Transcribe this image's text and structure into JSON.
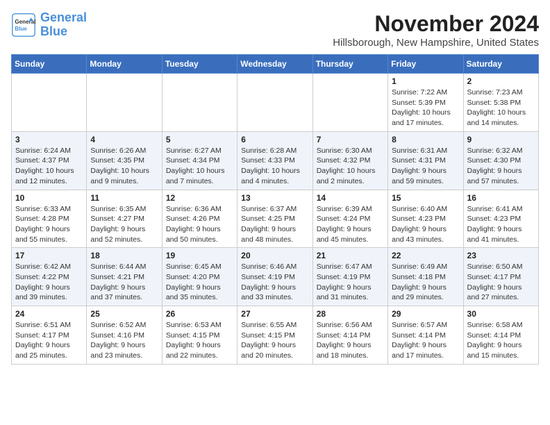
{
  "logo": {
    "text_general": "General",
    "text_blue": "Blue"
  },
  "header": {
    "month_year": "November 2024",
    "location": "Hillsborough, New Hampshire, United States"
  },
  "weekdays": [
    "Sunday",
    "Monday",
    "Tuesday",
    "Wednesday",
    "Thursday",
    "Friday",
    "Saturday"
  ],
  "weeks": [
    [
      {
        "day": "",
        "info": ""
      },
      {
        "day": "",
        "info": ""
      },
      {
        "day": "",
        "info": ""
      },
      {
        "day": "",
        "info": ""
      },
      {
        "day": "",
        "info": ""
      },
      {
        "day": "1",
        "info": "Sunrise: 7:22 AM\nSunset: 5:39 PM\nDaylight: 10 hours and 17 minutes."
      },
      {
        "day": "2",
        "info": "Sunrise: 7:23 AM\nSunset: 5:38 PM\nDaylight: 10 hours and 14 minutes."
      }
    ],
    [
      {
        "day": "3",
        "info": "Sunrise: 6:24 AM\nSunset: 4:37 PM\nDaylight: 10 hours and 12 minutes."
      },
      {
        "day": "4",
        "info": "Sunrise: 6:26 AM\nSunset: 4:35 PM\nDaylight: 10 hours and 9 minutes."
      },
      {
        "day": "5",
        "info": "Sunrise: 6:27 AM\nSunset: 4:34 PM\nDaylight: 10 hours and 7 minutes."
      },
      {
        "day": "6",
        "info": "Sunrise: 6:28 AM\nSunset: 4:33 PM\nDaylight: 10 hours and 4 minutes."
      },
      {
        "day": "7",
        "info": "Sunrise: 6:30 AM\nSunset: 4:32 PM\nDaylight: 10 hours and 2 minutes."
      },
      {
        "day": "8",
        "info": "Sunrise: 6:31 AM\nSunset: 4:31 PM\nDaylight: 9 hours and 59 minutes."
      },
      {
        "day": "9",
        "info": "Sunrise: 6:32 AM\nSunset: 4:30 PM\nDaylight: 9 hours and 57 minutes."
      }
    ],
    [
      {
        "day": "10",
        "info": "Sunrise: 6:33 AM\nSunset: 4:28 PM\nDaylight: 9 hours and 55 minutes."
      },
      {
        "day": "11",
        "info": "Sunrise: 6:35 AM\nSunset: 4:27 PM\nDaylight: 9 hours and 52 minutes."
      },
      {
        "day": "12",
        "info": "Sunrise: 6:36 AM\nSunset: 4:26 PM\nDaylight: 9 hours and 50 minutes."
      },
      {
        "day": "13",
        "info": "Sunrise: 6:37 AM\nSunset: 4:25 PM\nDaylight: 9 hours and 48 minutes."
      },
      {
        "day": "14",
        "info": "Sunrise: 6:39 AM\nSunset: 4:24 PM\nDaylight: 9 hours and 45 minutes."
      },
      {
        "day": "15",
        "info": "Sunrise: 6:40 AM\nSunset: 4:23 PM\nDaylight: 9 hours and 43 minutes."
      },
      {
        "day": "16",
        "info": "Sunrise: 6:41 AM\nSunset: 4:23 PM\nDaylight: 9 hours and 41 minutes."
      }
    ],
    [
      {
        "day": "17",
        "info": "Sunrise: 6:42 AM\nSunset: 4:22 PM\nDaylight: 9 hours and 39 minutes."
      },
      {
        "day": "18",
        "info": "Sunrise: 6:44 AM\nSunset: 4:21 PM\nDaylight: 9 hours and 37 minutes."
      },
      {
        "day": "19",
        "info": "Sunrise: 6:45 AM\nSunset: 4:20 PM\nDaylight: 9 hours and 35 minutes."
      },
      {
        "day": "20",
        "info": "Sunrise: 6:46 AM\nSunset: 4:19 PM\nDaylight: 9 hours and 33 minutes."
      },
      {
        "day": "21",
        "info": "Sunrise: 6:47 AM\nSunset: 4:19 PM\nDaylight: 9 hours and 31 minutes."
      },
      {
        "day": "22",
        "info": "Sunrise: 6:49 AM\nSunset: 4:18 PM\nDaylight: 9 hours and 29 minutes."
      },
      {
        "day": "23",
        "info": "Sunrise: 6:50 AM\nSunset: 4:17 PM\nDaylight: 9 hours and 27 minutes."
      }
    ],
    [
      {
        "day": "24",
        "info": "Sunrise: 6:51 AM\nSunset: 4:17 PM\nDaylight: 9 hours and 25 minutes."
      },
      {
        "day": "25",
        "info": "Sunrise: 6:52 AM\nSunset: 4:16 PM\nDaylight: 9 hours and 23 minutes."
      },
      {
        "day": "26",
        "info": "Sunrise: 6:53 AM\nSunset: 4:15 PM\nDaylight: 9 hours and 22 minutes."
      },
      {
        "day": "27",
        "info": "Sunrise: 6:55 AM\nSunset: 4:15 PM\nDaylight: 9 hours and 20 minutes."
      },
      {
        "day": "28",
        "info": "Sunrise: 6:56 AM\nSunset: 4:14 PM\nDaylight: 9 hours and 18 minutes."
      },
      {
        "day": "29",
        "info": "Sunrise: 6:57 AM\nSunset: 4:14 PM\nDaylight: 9 hours and 17 minutes."
      },
      {
        "day": "30",
        "info": "Sunrise: 6:58 AM\nSunset: 4:14 PM\nDaylight: 9 hours and 15 minutes."
      }
    ]
  ]
}
